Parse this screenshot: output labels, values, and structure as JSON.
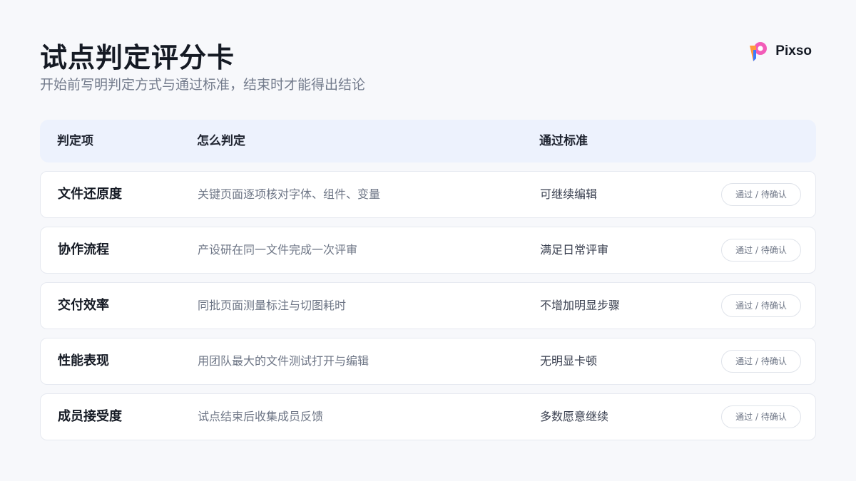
{
  "header": {
    "title": "试点判定评分卡",
    "subtitle": "开始前写明判定方式与通过标准，结束时才能得出结论"
  },
  "brand": {
    "name": "Pixso",
    "colors": {
      "pink": "#f25cb8",
      "orange": "#ff9a3c",
      "blue": "#3b7bff"
    }
  },
  "table": {
    "columns": [
      "判定项",
      "怎么判定",
      "通过标准"
    ],
    "rows": [
      {
        "item": "文件还原度",
        "method": "关键页面逐项核对字体、组件、变量",
        "criteria": "可继续编辑",
        "status": "通过 / 待确认"
      },
      {
        "item": "协作流程",
        "method": "产设研在同一文件完成一次评审",
        "criteria": "满足日常评审",
        "status": "通过 / 待确认"
      },
      {
        "item": "交付效率",
        "method": "同批页面测量标注与切图耗时",
        "criteria": "不增加明显步骤",
        "status": "通过 / 待确认"
      },
      {
        "item": "性能表现",
        "method": "用团队最大的文件测试打开与编辑",
        "criteria": "无明显卡顿",
        "status": "通过 / 待确认"
      },
      {
        "item": "成员接受度",
        "method": "试点结束后收集成员反馈",
        "criteria": "多数愿意继续",
        "status": "通过 / 待确认"
      }
    ]
  }
}
